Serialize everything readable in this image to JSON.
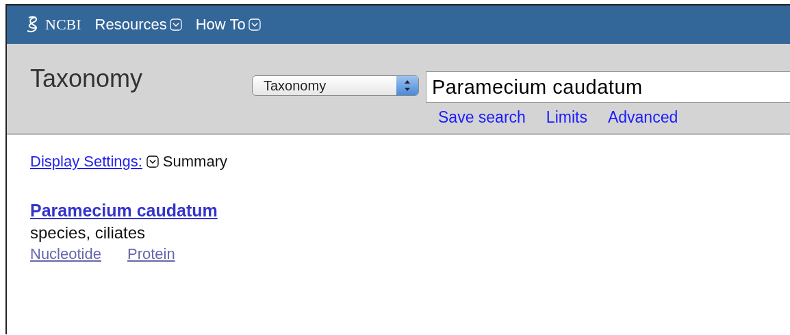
{
  "topbar": {
    "logo": "NCBI",
    "menus": [
      {
        "label": "Resources"
      },
      {
        "label": "How To"
      }
    ]
  },
  "header": {
    "title": "Taxonomy",
    "database_select": "Taxonomy",
    "search_value": "Paramecium caudatum",
    "links": [
      "Save search",
      "Limits",
      "Advanced"
    ]
  },
  "display_settings": {
    "link": "Display Settings:",
    "value": "Summary"
  },
  "results": [
    {
      "title": "Paramecium caudatum",
      "description": "species, ciliates",
      "links": [
        "Nucleotide",
        "Protein"
      ]
    }
  ]
}
